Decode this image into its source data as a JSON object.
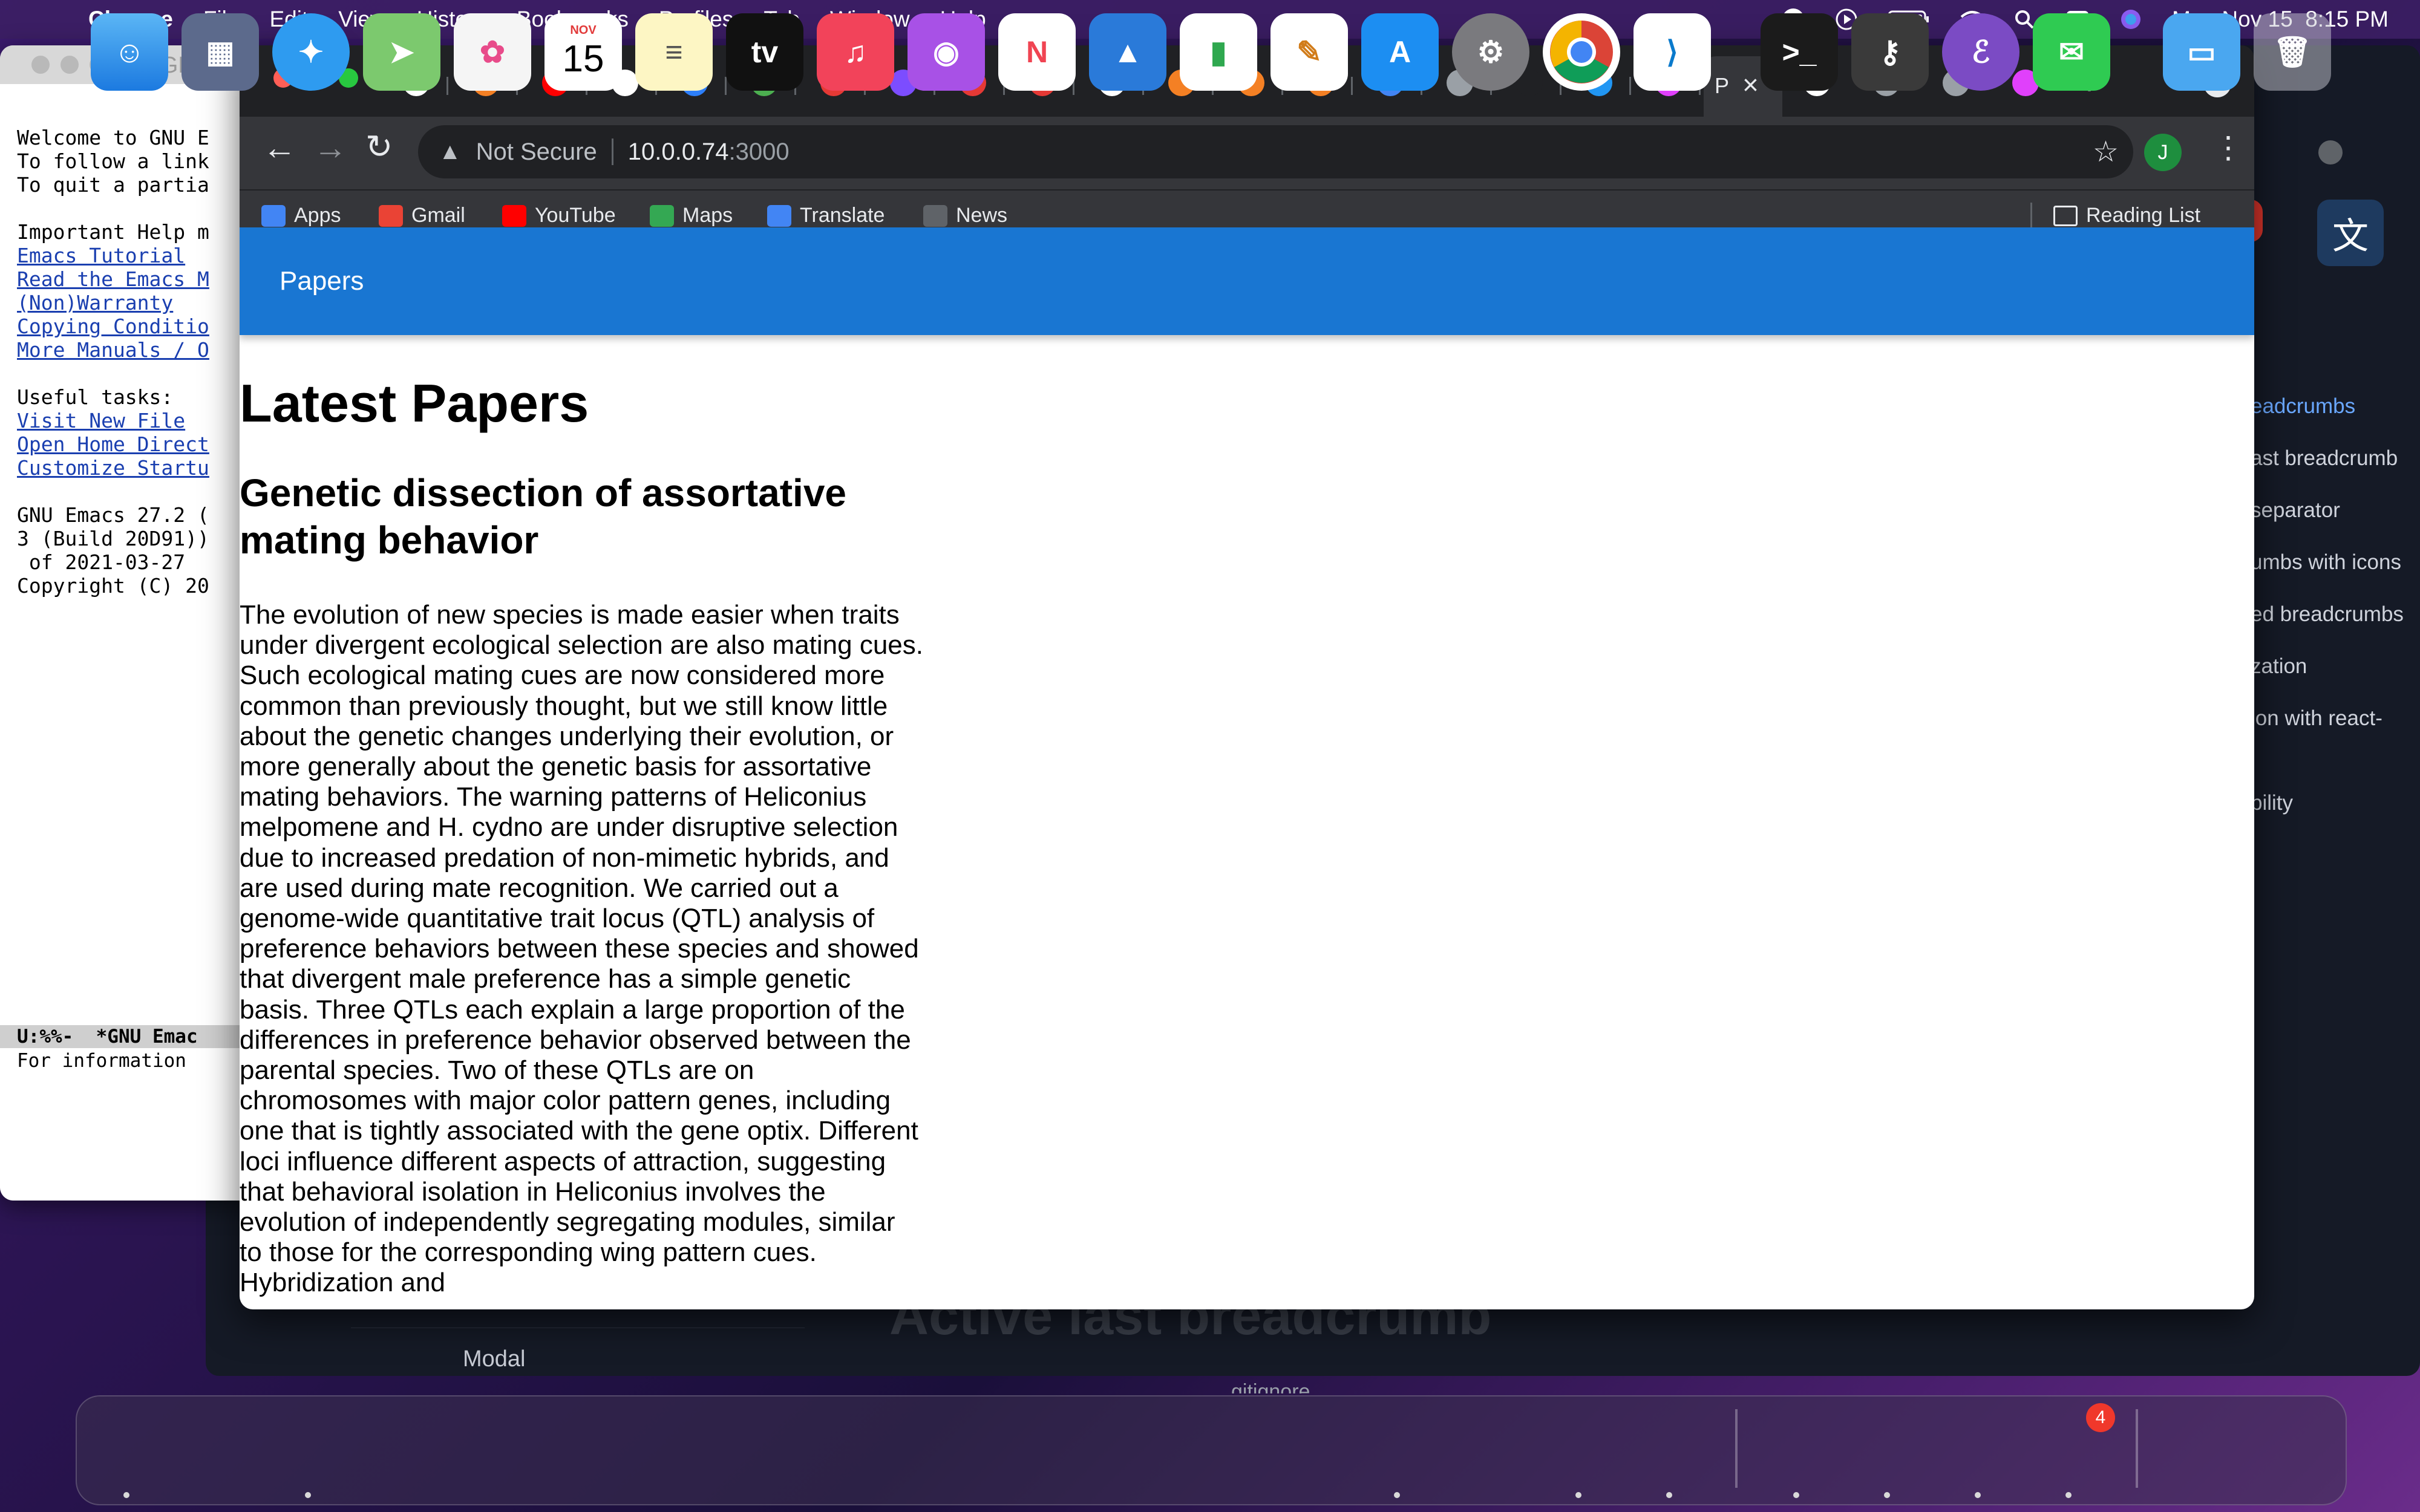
{
  "menubar": {
    "app_name": "Chrome",
    "items": [
      "File",
      "Edit",
      "View",
      "History",
      "Bookmarks",
      "Profiles",
      "Tab",
      "Window",
      "Help"
    ],
    "datetime": "Mon Nov 15  8:15 PM"
  },
  "emacs": {
    "title": "*GN",
    "lines": [
      {
        "text": "Welcome to GNU E",
        "link": false
      },
      {
        "text": "To follow a link",
        "link": false
      },
      {
        "text": "To quit a partia",
        "link": false
      },
      {
        "text": "",
        "link": false
      },
      {
        "text": "Important Help m",
        "link": false
      },
      {
        "text": "Emacs Tutorial",
        "link": true
      },
      {
        "text": "Read the Emacs M",
        "link": true
      },
      {
        "text": "(Non)Warranty",
        "link": true
      },
      {
        "text": "Copying Conditio",
        "link": true
      },
      {
        "text": "More Manuals / O",
        "link": true
      },
      {
        "text": "",
        "link": false
      },
      {
        "text": "Useful tasks:",
        "link": false
      },
      {
        "text": "Visit New File",
        "link": true
      },
      {
        "text": "Open Home Direct",
        "link": true
      },
      {
        "text": "Customize Startu",
        "link": true
      },
      {
        "text": "",
        "link": false
      },
      {
        "text": "GNU Emacs 27.2 (",
        "link": false
      },
      {
        "text": "3 (Build 20D91))",
        "link": false
      },
      {
        "text": " of 2021-03-27",
        "link": false
      },
      {
        "text": "Copyright (C) 20",
        "link": false
      }
    ],
    "modeline": "U:%%-  *GNU Emac",
    "echo": "For information"
  },
  "background_app": {
    "side_items": [
      {
        "text": "eadcrumbs",
        "active": true
      },
      {
        "text": "ast breadcrumb",
        "active": false
      },
      {
        "text": "separator",
        "active": false
      },
      {
        "text": "umbs with icons",
        "active": false
      },
      {
        "text": "ed breadcrumbs",
        "active": false
      },
      {
        "text": "zation",
        "active": false
      },
      {
        "text": "ion with react-",
        "active": false
      },
      {
        "text": "bility",
        "active": false
      }
    ],
    "bottom_left": "Modal",
    "bottom_heading": "Active last breadcrumb",
    "bottom_file": "gitignore"
  },
  "browser": {
    "active_tab_label": "P",
    "address_security": "Not Secure",
    "address_host": "10.0.0.74",
    "address_port": ":3000",
    "profile_initial": "J",
    "bookmarks": [
      {
        "label": "Apps",
        "icon": "apps-grid-icon",
        "color": "#4285f4"
      },
      {
        "label": "Gmail",
        "icon": "gmail-icon",
        "color": "#ea4335"
      },
      {
        "label": "YouTube",
        "icon": "youtube-icon",
        "color": "#ff0000"
      },
      {
        "label": "Maps",
        "icon": "maps-icon",
        "color": "#34a853"
      },
      {
        "label": "Translate",
        "icon": "translate-icon",
        "color": "#4285f4"
      },
      {
        "label": "News",
        "icon": "news-icon",
        "color": "#5f6368"
      }
    ],
    "reading_list": "Reading List"
  },
  "page": {
    "appbar_title": "Papers",
    "heading": "Latest Papers",
    "paper": {
      "title": "Genetic dissection of assortative mating behavior",
      "abstract": "The evolution of new species is made easier when traits under divergent ecological selection are also mating cues. Such ecological mating cues are now considered more common than previously thought, but we still know little about the genetic changes underlying their evolution, or more generally about the genetic basis for assortative mating behaviors. The warning patterns of Heliconius melpomene and H. cydno are under disruptive selection due to increased predation of non-mimetic hybrids, and are used during mate recognition. We carried out a genome-wide quantitative trait locus (QTL) analysis of preference behaviors between these species and showed that divergent male preference has a simple genetic basis. Three QTLs each explain a large proportion of the differences in preference behavior observed between the parental species. Two of these QTLs are on chromosomes with major color pattern genes, including one that is tightly associated with the gene optix. Different loci influence different aspects of attraction, suggesting that behavioral isolation in Heliconius involves the evolution of independently segregating modules, similar to those for the corresponding wing pattern cues. Hybridization and"
    }
  },
  "dock": {
    "calendar_month": "NOV",
    "calendar_day": "15",
    "tv_label": "tv",
    "messages_badge": "4"
  },
  "colors": {
    "appbar": "#1976d2",
    "chrome_frame": "#202124",
    "chrome_toolbar": "#35363a"
  }
}
